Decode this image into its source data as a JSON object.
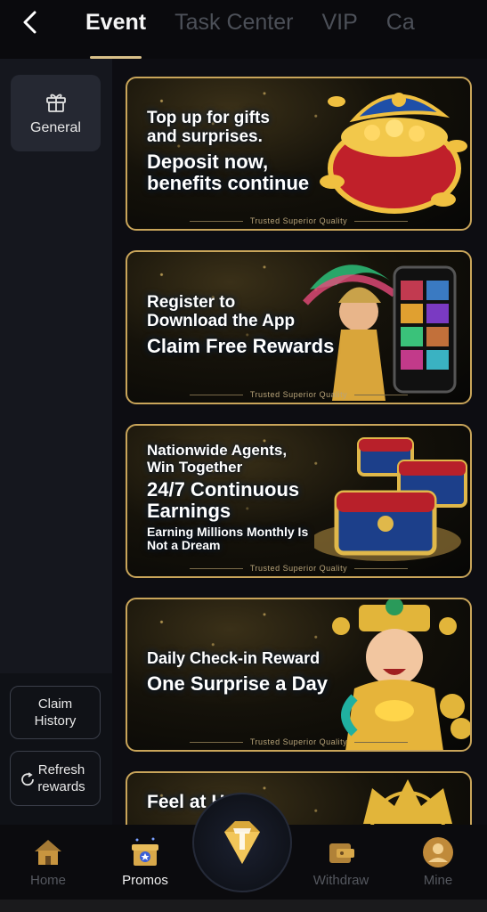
{
  "header": {
    "back_icon": "chevron-left-icon",
    "tabs": [
      {
        "label": "Event",
        "active": true
      },
      {
        "label": "Task Center",
        "active": false
      },
      {
        "label": "VIP",
        "active": false
      },
      {
        "label": "Ca",
        "active": false
      }
    ]
  },
  "sidebar": {
    "categories": [
      {
        "label": "General",
        "icon": "gift-icon",
        "active": true
      }
    ],
    "claim_history_label": "Claim History",
    "refresh_label": "Refresh rewards",
    "refresh_icon": "refresh-icon"
  },
  "banners": [
    {
      "line1": "Top up for gifts",
      "line1b": "and surprises.",
      "line2": "Deposit now,",
      "line2b": "benefits continue",
      "footer": "Trusted Superior Quality"
    },
    {
      "line1": "Register to",
      "line1b": "Download the App",
      "line2": "Claim Free Rewards",
      "footer": "Trusted Superior Quality"
    },
    {
      "line1": "Nationwide Agents,",
      "line1b": "Win Together",
      "line2": "24/7 Continuous",
      "line2b": "Earnings",
      "line3": "Earning Millions Monthly Is",
      "line3b": "Not a Dream",
      "footer": "Trusted Superior Quality"
    },
    {
      "line1": "Daily Check-in Reward",
      "line2": "One Surprise a Day",
      "footer": "Trusted Superior Quality"
    },
    {
      "line1": "Feel at Home"
    }
  ],
  "bottom_nav": [
    {
      "label": "Home",
      "icon": "home-icon",
      "active": false
    },
    {
      "label": "Promos",
      "icon": "promo-gift-icon",
      "active": true
    },
    {
      "label": "Withdraw",
      "icon": "wallet-icon",
      "active": false
    },
    {
      "label": "Mine",
      "icon": "user-icon",
      "active": false
    }
  ],
  "colors": {
    "accent_gold": "#c9a55a",
    "bg": "#0d0d12",
    "sidebar_bg": "#15171e"
  }
}
